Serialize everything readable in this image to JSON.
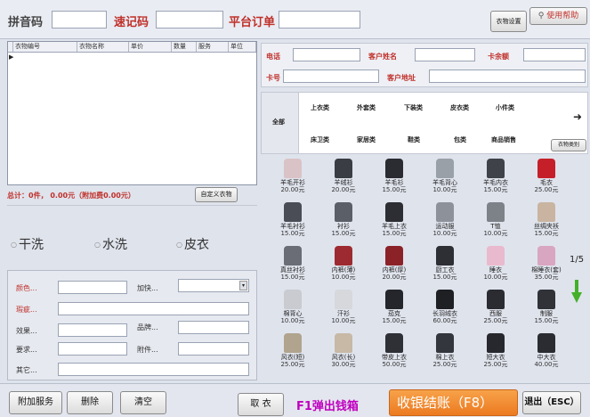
{
  "topbar": {
    "pinyin_label": "拼音码",
    "quick_label": "速记码",
    "platform_label": "平台订单",
    "settings_button": "衣物设置",
    "help_button": "使用帮助"
  },
  "grid": {
    "columns": [
      "衣物编号",
      "衣物名称",
      "单价",
      "数量",
      "服务",
      "单位"
    ]
  },
  "summary": {
    "text": "总计：0件， 0.00元（附加费0.00元）",
    "custom_button": "自定义衣物"
  },
  "wash_types": [
    "干洗",
    "水洗",
    "皮衣"
  ],
  "attributes": {
    "color_label": "颜色...",
    "flaw_label": "瑕疵...",
    "effect_label": "效果...",
    "request_label": "要求...",
    "other_label": "其它...",
    "urgent_label": "加快...",
    "brand_label": "品牌...",
    "attachment_label": "附件..."
  },
  "customer": {
    "phone_label": "电话",
    "name_label": "客户姓名",
    "balance_label": "卡余额",
    "card_label": "卡号",
    "address_label": "客户地址"
  },
  "categories": {
    "all": "全部",
    "row1": [
      "上衣类",
      "外套类",
      "下装类",
      "皮衣类",
      "小件类"
    ],
    "row2": [
      "床卫类",
      "家居类",
      "鞋类",
      "包类",
      "商品销售"
    ],
    "category_button": "衣物类别"
  },
  "products": [
    {
      "name": "羊毛开衫",
      "price": "20.00元",
      "color": "#d9c3c6"
    },
    {
      "name": "羊绒衫",
      "price": "20.00元",
      "color": "#3a3d44"
    },
    {
      "name": "羊毛衫",
      "price": "15.00元",
      "color": "#2b2c31"
    },
    {
      "name": "羊毛背心",
      "price": "10.00元",
      "color": "#9aa0a8"
    },
    {
      "name": "羊毛内衣",
      "price": "15.00元",
      "color": "#3f4248"
    },
    {
      "name": "毛衣",
      "price": "25.00元",
      "color": "#c5202a"
    },
    {
      "name": "羊毛衬衫",
      "price": "15.00元",
      "color": "#4a4d55"
    },
    {
      "name": "衬衫",
      "price": "15.00元",
      "color": "#5b5f68"
    },
    {
      "name": "羊毛上衣",
      "price": "15.00元",
      "color": "#2c2e33"
    },
    {
      "name": "运动服",
      "price": "10.00元",
      "color": "#8d9199"
    },
    {
      "name": "T恤",
      "price": "10.00元",
      "color": "#7d8188"
    },
    {
      "name": "丝绸夹袄",
      "price": "15.00元",
      "color": "#c8b4a0"
    },
    {
      "name": "真丝衬衫",
      "price": "15.00元",
      "color": "#6a6d75"
    },
    {
      "name": "内裤(薄)",
      "price": "10.00元",
      "color": "#9d2a30"
    },
    {
      "name": "内裤(厚)",
      "price": "20.00元",
      "color": "#8b2228"
    },
    {
      "name": "厨工衣",
      "price": "15.00元",
      "color": "#2d2f34"
    },
    {
      "name": "睡衣",
      "price": "10.00元",
      "color": "#e9b9cd"
    },
    {
      "name": "棉睡衣(套)",
      "price": "35.00元",
      "color": "#d8a6c0"
    },
    {
      "name": "棉背心",
      "price": "10.00元",
      "color": "#c9cbd0"
    },
    {
      "name": "汗衫",
      "price": "10.00元",
      "color": "#d6d8dc"
    },
    {
      "name": "茄克",
      "price": "15.00元",
      "color": "#24262b"
    },
    {
      "name": "长羽绒衣",
      "price": "60.00元",
      "color": "#1f2024"
    },
    {
      "name": "西服",
      "price": "25.00元",
      "color": "#2a2c31"
    },
    {
      "name": "制服",
      "price": "15.00元",
      "color": "#303238"
    },
    {
      "name": "风衣(短)",
      "price": "25.00元",
      "color": "#b0a48e"
    },
    {
      "name": "风衣(长)",
      "price": "30.00元",
      "color": "#c7b9a6"
    },
    {
      "name": "带皮上衣",
      "price": "50.00元",
      "color": "#2e3036"
    },
    {
      "name": "棉上衣",
      "price": "25.00元",
      "color": "#33363c"
    },
    {
      "name": "短大衣",
      "price": "25.00元",
      "color": "#26282d"
    },
    {
      "name": "中大衣",
      "price": "40.00元",
      "color": "#2a2c31"
    }
  ],
  "pager": {
    "text": "1/5"
  },
  "bottom": {
    "extra_service": "附加服务",
    "delete": "删除",
    "clear": "清空",
    "pickup": "取 衣",
    "cash_drawer": "F1弹出钱箱",
    "checkout": "收银结账（F8）",
    "exit": "退出（ESC）"
  },
  "colors": {
    "accent_red": "#c0302a",
    "checkout_orange": "#f28c30",
    "magenta": "#c000c0"
  }
}
